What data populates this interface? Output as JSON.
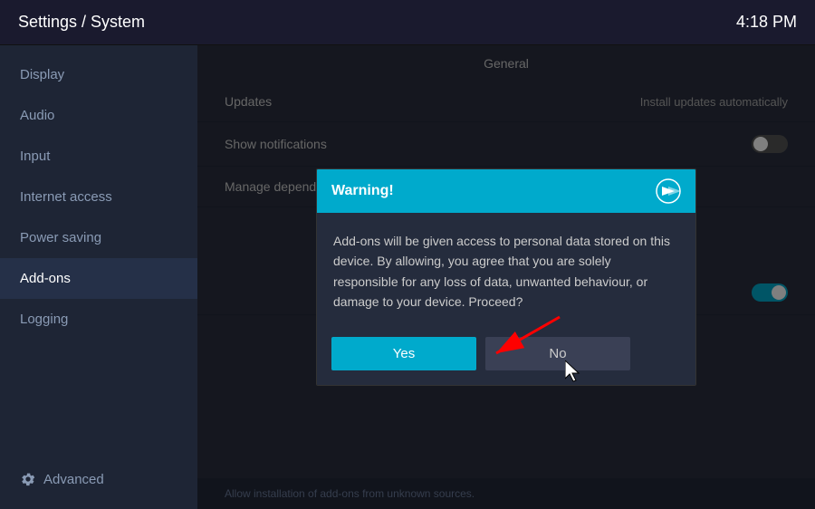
{
  "header": {
    "title": "Settings / System",
    "time": "4:18 PM"
  },
  "sidebar": {
    "items": [
      {
        "id": "display",
        "label": "Display",
        "active": false
      },
      {
        "id": "audio",
        "label": "Audio",
        "active": false
      },
      {
        "id": "input",
        "label": "Input",
        "active": false
      },
      {
        "id": "internet-access",
        "label": "Internet access",
        "active": false
      },
      {
        "id": "power-saving",
        "label": "Power saving",
        "active": false
      },
      {
        "id": "add-ons",
        "label": "Add-ons",
        "active": true
      },
      {
        "id": "logging",
        "label": "Logging",
        "active": false
      }
    ],
    "advanced_label": "Advanced"
  },
  "main": {
    "section_label": "General",
    "settings": [
      {
        "id": "updates",
        "label": "Updates",
        "value": "Install updates automatically",
        "has_toggle": false
      },
      {
        "id": "show-notifications",
        "label": "Show notifications",
        "value": "",
        "has_toggle": true,
        "toggle_on": false
      },
      {
        "id": "manage-dependencies",
        "label": "Manage dependencies",
        "value": "",
        "has_toggle": false
      }
    ],
    "unknown_sources_row": {
      "has_toggle": true,
      "toggle_on": true
    },
    "footer_text": "Allow installation of add-ons from unknown sources."
  },
  "dialog": {
    "title": "Warning!",
    "body": "Add-ons will be given access to personal data stored on this device. By allowing, you agree that you are solely responsible for any loss of data, unwanted behaviour, or damage to your device. Proceed?",
    "btn_yes": "Yes",
    "btn_no": "No"
  }
}
